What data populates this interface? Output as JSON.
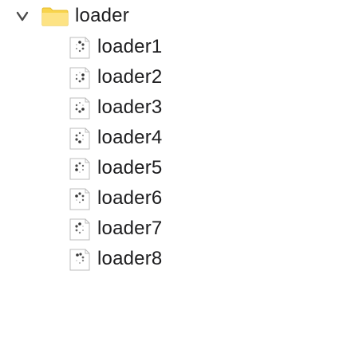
{
  "folder": {
    "label": "loader",
    "expanded": true,
    "icon": "folder-icon",
    "disclosure_icon": "chevron-down-icon",
    "folder_color": "#f9d54f"
  },
  "files": [
    {
      "label": "loader1",
      "icon": "loader-file-icon"
    },
    {
      "label": "loader2",
      "icon": "loader-file-icon"
    },
    {
      "label": "loader3",
      "icon": "loader-file-icon"
    },
    {
      "label": "loader4",
      "icon": "loader-file-icon"
    },
    {
      "label": "loader5",
      "icon": "loader-file-icon"
    },
    {
      "label": "loader6",
      "icon": "loader-file-icon"
    },
    {
      "label": "loader7",
      "icon": "loader-file-icon"
    },
    {
      "label": "loader8",
      "icon": "loader-file-icon"
    }
  ]
}
